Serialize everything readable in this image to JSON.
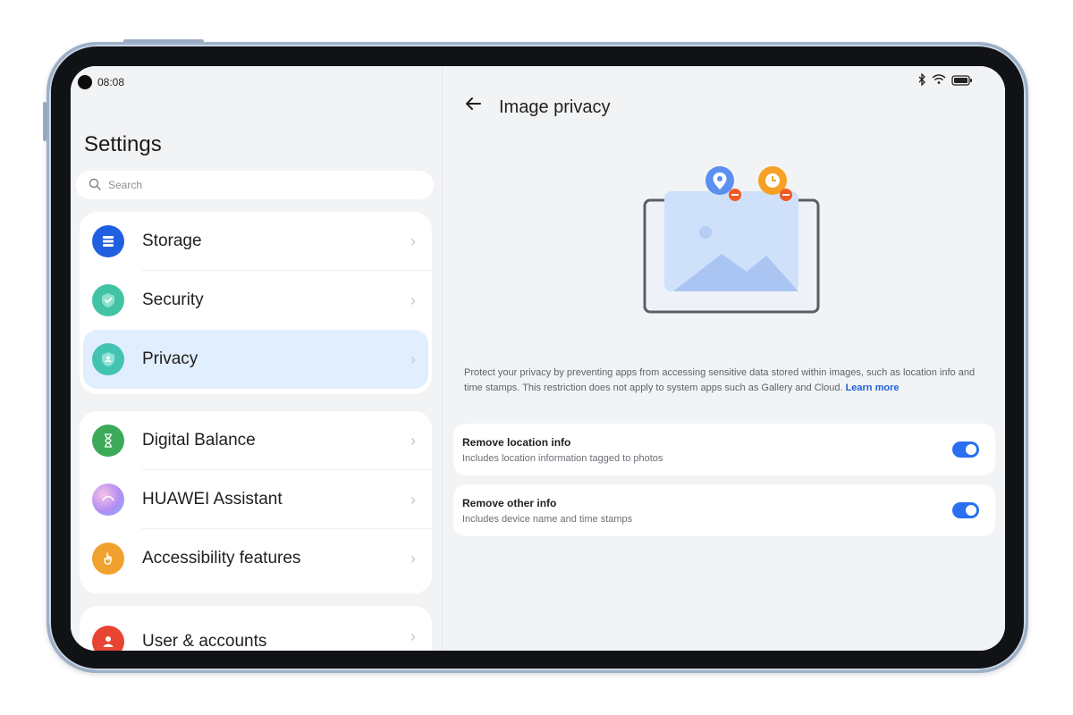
{
  "status": {
    "time": "08:08"
  },
  "left": {
    "title": "Settings",
    "search_placeholder": "Search",
    "groups": [
      {
        "items": [
          {
            "label": "Storage",
            "icon": "storage-icon",
            "color": "#1f5fe0"
          },
          {
            "label": "Security",
            "icon": "shield-check-icon",
            "color": "#43c3a5"
          },
          {
            "label": "Privacy",
            "icon": "privacy-shield-icon",
            "color": "#43c3b2",
            "selected": true
          }
        ]
      },
      {
        "items": [
          {
            "label": "Digital Balance",
            "icon": "hourglass-icon",
            "color": "#3daa5a"
          },
          {
            "label": "HUAWEI Assistant",
            "icon": "assistant-orb-icon",
            "color": "#b28df2"
          },
          {
            "label": "Accessibility features",
            "icon": "hand-pointer-icon",
            "color": "#f1a12d"
          }
        ]
      },
      {
        "items": [
          {
            "label": "User & accounts",
            "icon": "user-icon",
            "color": "#e74433"
          }
        ]
      }
    ]
  },
  "right": {
    "page_title": "Image privacy",
    "description": "Protect your privacy by preventing apps from accessing sensitive data stored within images, such as location info and time stamps. This restriction does not apply to system apps such as Gallery and Cloud.",
    "learn_more": "Learn more",
    "options": [
      {
        "title": "Remove location info",
        "subtitle": "Includes location information tagged to photos",
        "enabled": true
      },
      {
        "title": "Remove other info",
        "subtitle": "Includes device name and time stamps",
        "enabled": true
      }
    ]
  },
  "colors": {
    "accent": "#2b6ff2",
    "selection_bg": "#e1eefd",
    "link": "#1f62dd"
  }
}
